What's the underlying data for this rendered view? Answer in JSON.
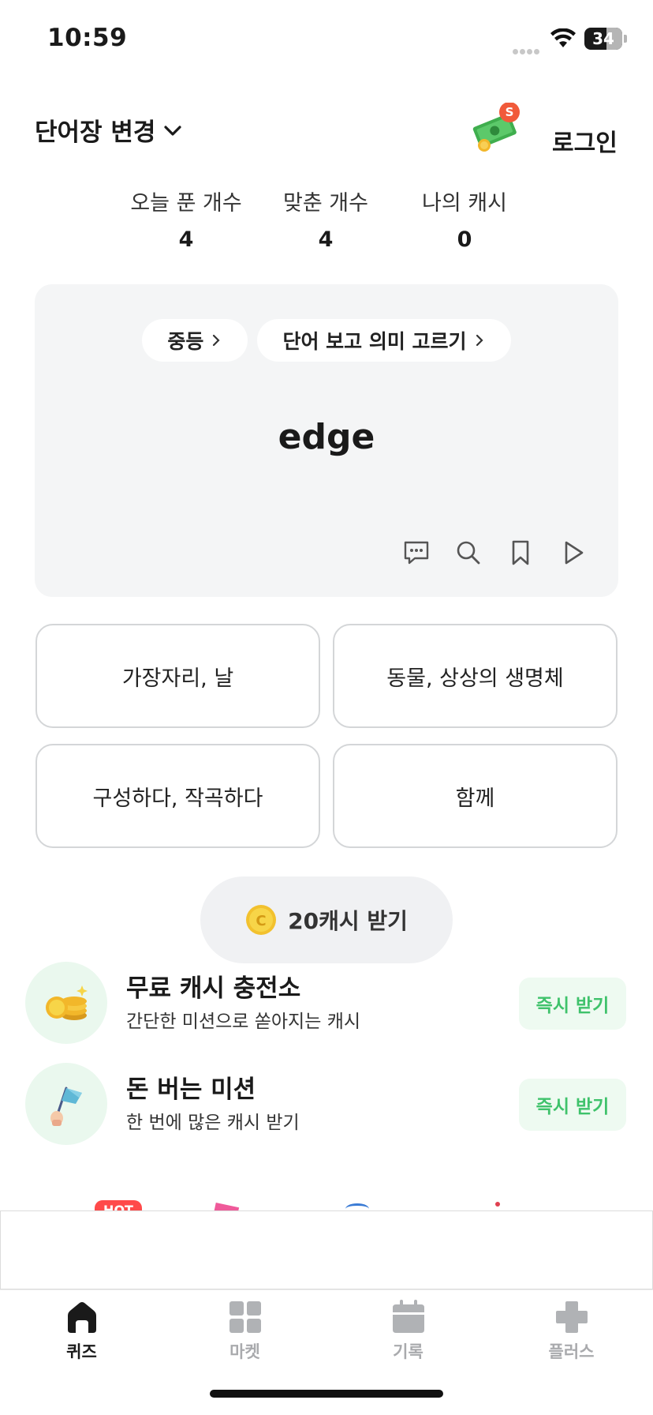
{
  "status_bar": {
    "time": "10:59",
    "battery": "34",
    "battery_level": 0.34
  },
  "header": {
    "wordbook_change": "단어장 변경",
    "cash_badge": "S",
    "login": "로그인"
  },
  "stats": [
    {
      "label": "오늘 푼 개수",
      "value": "4"
    },
    {
      "label": "맞춘 개수",
      "value": "4"
    },
    {
      "label": "나의 캐시",
      "value": "0"
    }
  ],
  "quiz": {
    "level": "중등",
    "mode": "단어 보고 의미 고르기",
    "word": "edge",
    "actions": [
      "comment-icon",
      "search-icon",
      "bookmark-icon",
      "play-icon"
    ]
  },
  "options": [
    "가장자리, 날",
    "동물, 상상의 생명체",
    "구성하다, 작곡하다",
    "함께"
  ],
  "get_cash": {
    "coin": "C",
    "label": "20캐시 받기"
  },
  "missions": [
    {
      "title": "무료 캐시 충전소",
      "subtitle": "간단한 미션으로 쏟아지는 캐시",
      "button": "즉시 받기",
      "icon": "coins-icon"
    },
    {
      "title": "돈 버는 미션",
      "subtitle": "한 번에 많은 캐시 받기",
      "button": "즉시 받기",
      "icon": "flag-icon"
    }
  ],
  "peek": {
    "hot": "HOT"
  },
  "tabs": [
    {
      "label": "퀴즈",
      "icon": "home-icon",
      "active": true
    },
    {
      "label": "마켓",
      "icon": "grid-icon",
      "active": false
    },
    {
      "label": "기록",
      "icon": "calendar-icon",
      "active": false
    },
    {
      "label": "플러스",
      "icon": "plus-icon",
      "active": false
    }
  ],
  "colors": {
    "accent_green": "#3fc26b",
    "card_bg": "#f4f5f6",
    "badge_red": "#f15a3a",
    "hot_red": "#ff4a4a"
  }
}
